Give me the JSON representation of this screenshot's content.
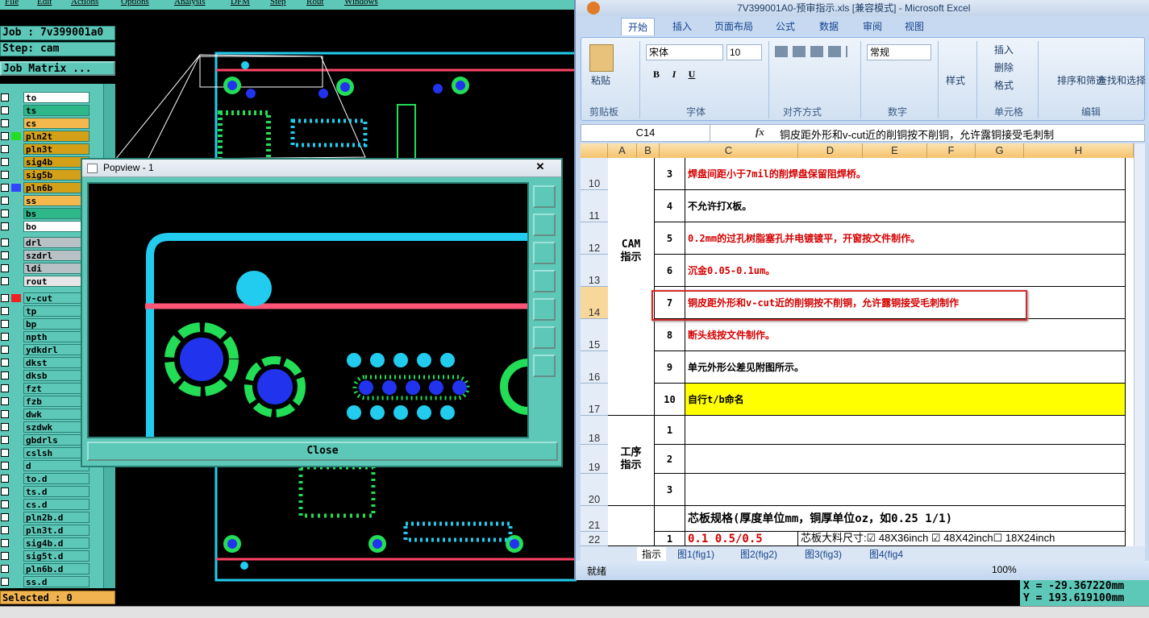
{
  "cam": {
    "menu": [
      "File",
      "Edit",
      "Actions",
      "Options",
      "Analysis",
      "DFM",
      "Step",
      "Rout",
      "Windows"
    ],
    "job": "Job : 7v399001a0",
    "step": "Step: cam",
    "matrix": "Job Matrix ...",
    "layers": [
      {
        "name": "to",
        "color": "#ffffff"
      },
      {
        "name": "ts",
        "color": "#2eb889"
      },
      {
        "name": "cs",
        "color": "#f5b84d"
      },
      {
        "name": "pln2t",
        "color": "#d4a017",
        "sw": "#22dd22"
      },
      {
        "name": "pln3t",
        "color": "#d4a017"
      },
      {
        "name": "sig4b",
        "color": "#d4a017"
      },
      {
        "name": "sig5b",
        "color": "#d4a017"
      },
      {
        "name": "pln6b",
        "color": "#d4a017",
        "sw": "#3344ff"
      },
      {
        "name": "ss",
        "color": "#f5b84d"
      },
      {
        "name": "bs",
        "color": "#2eb889"
      },
      {
        "name": "bo",
        "color": "#ffffff"
      },
      {
        "name": "drl",
        "color": "#b8c2c6"
      },
      {
        "name": "szdrl",
        "color": "#b8c2c6"
      },
      {
        "name": "ldi",
        "color": "#b8c2c6"
      },
      {
        "name": "rout",
        "color": "#e6e6e6"
      },
      {
        "name": "v-cut",
        "color": "#5ec8b8",
        "sw": "#ee2222"
      },
      {
        "name": "tp",
        "color": "#5ec8b8"
      },
      {
        "name": "bp",
        "color": "#5ec8b8"
      },
      {
        "name": "npth",
        "color": "#5ec8b8"
      },
      {
        "name": "ydkdrl",
        "color": "#5ec8b8"
      },
      {
        "name": "dkst",
        "color": "#5ec8b8"
      },
      {
        "name": "dksb",
        "color": "#5ec8b8"
      },
      {
        "name": "fzt",
        "color": "#5ec8b8"
      },
      {
        "name": "fzb",
        "color": "#5ec8b8"
      },
      {
        "name": "dwk",
        "color": "#5ec8b8"
      },
      {
        "name": "szdwk",
        "color": "#5ec8b8"
      },
      {
        "name": "gbdrls",
        "color": "#5ec8b8"
      },
      {
        "name": "cslsh",
        "color": "#5ec8b8"
      },
      {
        "name": "d",
        "color": "#5ec8b8"
      },
      {
        "name": "to.d",
        "color": "#5ec8b8"
      },
      {
        "name": "ts.d",
        "color": "#5ec8b8"
      },
      {
        "name": "cs.d",
        "color": "#5ec8b8"
      },
      {
        "name": "pln2b.d",
        "color": "#5ec8b8"
      },
      {
        "name": "pln3t.d",
        "color": "#5ec8b8"
      },
      {
        "name": "sig4b.d",
        "color": "#5ec8b8"
      },
      {
        "name": "sig5t.d",
        "color": "#5ec8b8"
      },
      {
        "name": "pln6b.d",
        "color": "#5ec8b8"
      },
      {
        "name": "ss.d",
        "color": "#5ec8b8"
      }
    ],
    "selected": "Selected : 0",
    "coords": {
      "x": "X = -29.367220mm",
      "y": "Y = 193.619100mm"
    }
  },
  "popview": {
    "title": "Popview - 1",
    "close_x": "✕",
    "close": "Close"
  },
  "excel": {
    "title": "7V399001A0-预审指示.xls  [兼容模式] - Microsoft Excel",
    "tabs": [
      "开始",
      "插入",
      "页面布局",
      "公式",
      "数据",
      "审阅",
      "视图"
    ],
    "font_name": "宋体",
    "font_size": "10",
    "number_format": "常规",
    "labels": {
      "paste": "粘贴",
      "clipboard": "剪贴板",
      "font": "字体",
      "align": "对齐方式",
      "number": "数字",
      "style": "样式",
      "cells": "单元格",
      "edit": "编辑",
      "insert": "插入",
      "delete": "删除",
      "format": "格式",
      "sort": "排序和筛选",
      "find": "查找和选择"
    },
    "namebox": "C14",
    "formula": "铜皮距外形和v-cut近的削铜按不削铜，允许露铜接受毛刺制",
    "columns": [
      "A",
      "B",
      "C",
      "D",
      "E",
      "F",
      "G",
      "H"
    ],
    "rows": [
      {
        "n": "10",
        "b": "3",
        "c": "焊盘间距小于7mil的削焊盘保留阻焊桥。",
        "red": true
      },
      {
        "n": "11",
        "b": "4",
        "c": "不允许打X板。",
        "red": false
      },
      {
        "n": "12",
        "b": "5",
        "c": "0.2mm的过孔树脂塞孔并电镀镀平，开窗按文件制作。",
        "red": true
      },
      {
        "n": "13",
        "b": "6",
        "c": "沉金0.05-0.1um。",
        "red": true
      },
      {
        "n": "14",
        "b": "7",
        "c": "铜皮距外形和v-cut近的削铜按不削铜，允许露铜接受毛刺制作",
        "red": true
      },
      {
        "n": "15",
        "b": "8",
        "c": "断头线按文件制作。",
        "red": true
      },
      {
        "n": "16",
        "b": "9",
        "c": "单元外形公差见附图所示。",
        "red": false
      },
      {
        "n": "17",
        "b": "10",
        "c": "自行t/b命名",
        "red": false
      },
      {
        "n": "18",
        "b": "1",
        "c": "",
        "red": false
      },
      {
        "n": "19",
        "b": "2",
        "c": "",
        "red": false
      },
      {
        "n": "20",
        "b": "3",
        "c": "",
        "red": false
      },
      {
        "n": "21",
        "b": "",
        "c": "芯板规格(厚度单位mm，铜厚单位oz，如0.25 1/1)",
        "red": false
      },
      {
        "n": "22",
        "b": "1",
        "c": "0.1 0.5/0.5",
        "red": true
      }
    ],
    "group_cam": "CAM\n指示",
    "group_proc": "工序\n指示",
    "row22_d": "芯板大料尺寸:☑ 48X36inch ☑ 48X42inch☐ 18X24inch",
    "sheets": [
      "指示",
      "图1(fig1)",
      "图2(fig2)",
      "图3(fig3)",
      "图4(fig4"
    ],
    "status": "就绪",
    "zoom": "100%"
  }
}
